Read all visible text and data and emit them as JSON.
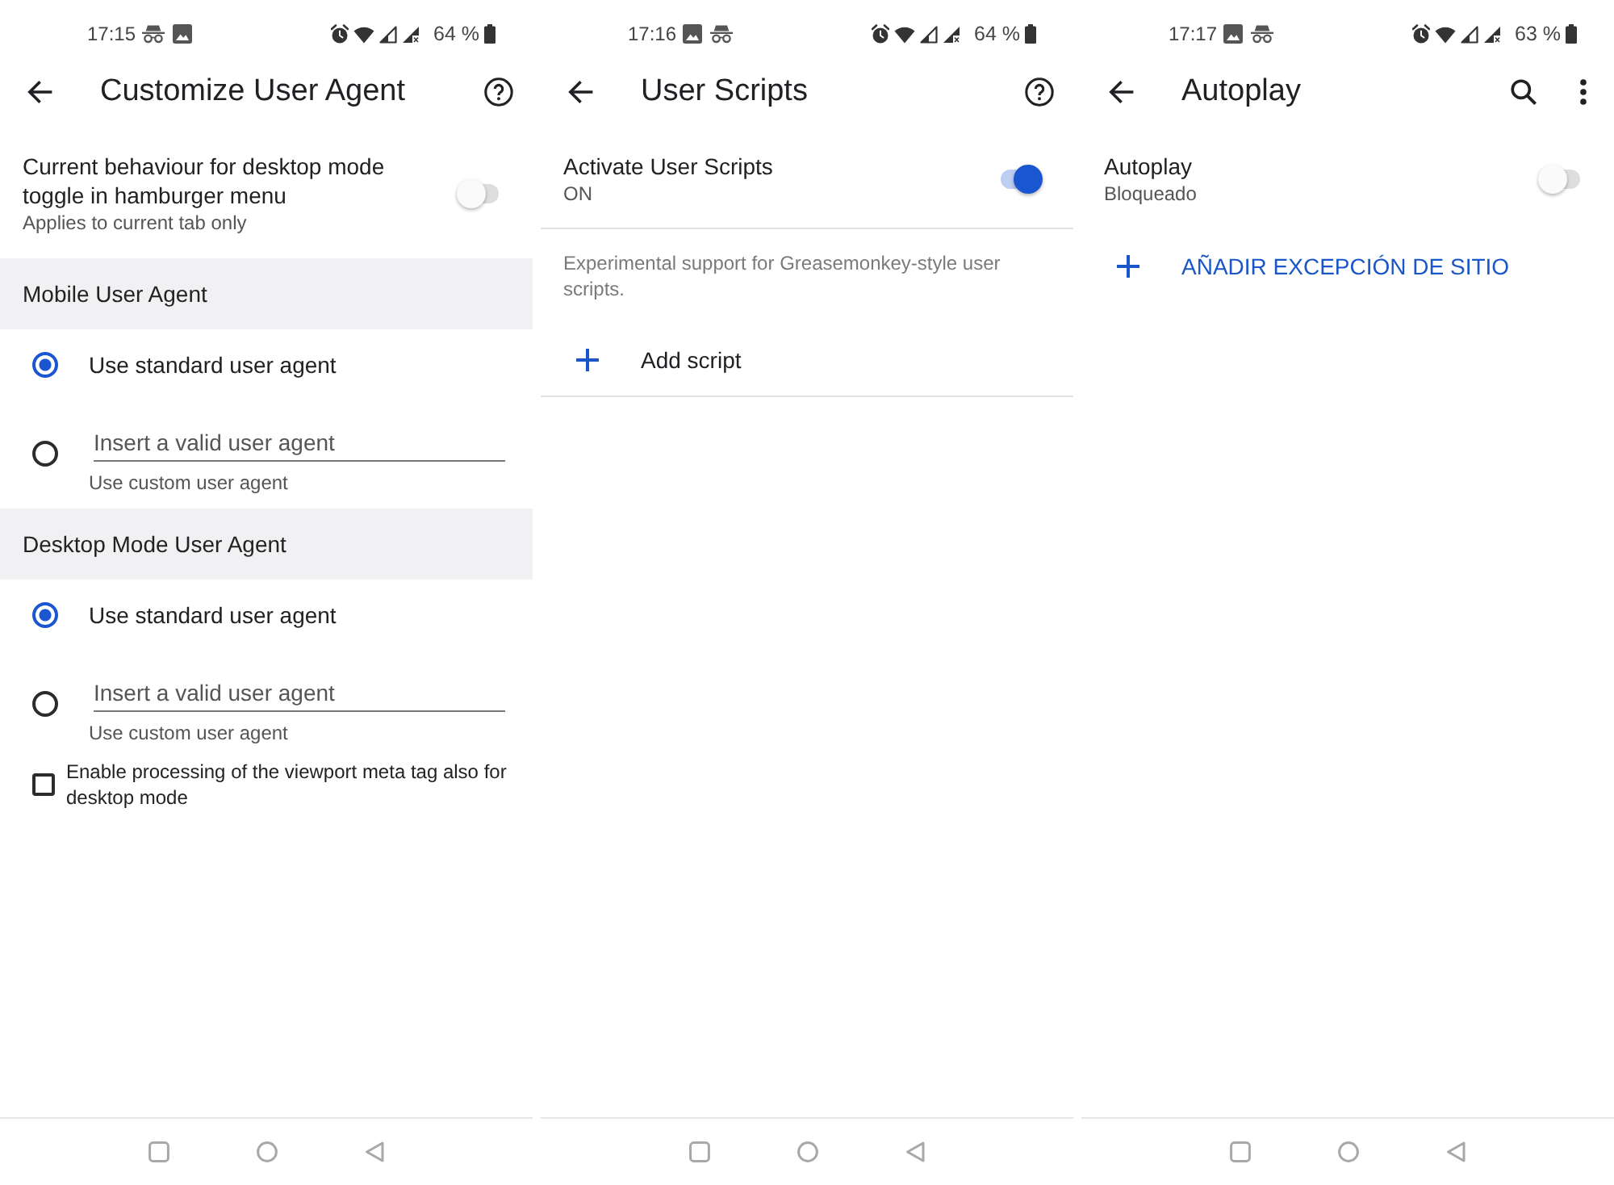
{
  "screens": [
    {
      "status_bar": {
        "time": "17:15",
        "notification_icons": [
          {
            "kind": "incognito"
          },
          {
            "kind": "image"
          }
        ],
        "battery": "64 %"
      },
      "toolbar": {
        "title": "Customize User Agent",
        "actions": [
          {
            "kind": "help"
          }
        ]
      },
      "items": [
        {
          "kind": "switch",
          "title": "Current behaviour for desktop mode toggle in hamburger menu",
          "subtitle": "Applies to current tab only",
          "on": false
        },
        {
          "kind": "header",
          "label": "Mobile User Agent"
        },
        {
          "kind": "radio",
          "label": "Use standard user agent",
          "selected": true
        },
        {
          "kind": "radio_input",
          "placeholder": "Insert a valid user agent",
          "hint": "Use custom user agent",
          "selected": false
        },
        {
          "kind": "header",
          "label": "Desktop Mode User Agent"
        },
        {
          "kind": "radio",
          "label": "Use standard user agent",
          "selected": true
        },
        {
          "kind": "radio_input",
          "placeholder": "Insert a valid user agent",
          "hint": "Use custom user agent",
          "selected": false
        },
        {
          "kind": "checkbox",
          "label": "Enable processing of the viewport meta tag also for desktop mode",
          "checked": false
        }
      ]
    },
    {
      "status_bar": {
        "time": "17:16",
        "notification_icons": [
          {
            "kind": "image"
          },
          {
            "kind": "incognito"
          }
        ],
        "battery": "64 %"
      },
      "toolbar": {
        "title": "User Scripts",
        "actions": [
          {
            "kind": "help"
          }
        ]
      },
      "items": [
        {
          "kind": "switch",
          "title": "Activate User Scripts",
          "subtitle": "ON",
          "on": true,
          "divider_below": true
        },
        {
          "kind": "note",
          "text": "Experimental support for Greasemonkey-style user scripts."
        },
        {
          "kind": "add",
          "label": "Add script",
          "accent": false,
          "divider_below": true
        }
      ]
    },
    {
      "status_bar": {
        "time": "17:17",
        "notification_icons": [
          {
            "kind": "image"
          },
          {
            "kind": "incognito"
          }
        ],
        "battery": "63 %"
      },
      "toolbar": {
        "title": "Autoplay",
        "actions": [
          {
            "kind": "search"
          },
          {
            "kind": "more"
          }
        ]
      },
      "items": [
        {
          "kind": "switch",
          "title": "Autoplay",
          "subtitle": "Bloqueado",
          "on": false
        },
        {
          "kind": "add",
          "label": "AÑADIR EXCEPCIÓN DE SITIO",
          "accent": true
        }
      ]
    }
  ]
}
